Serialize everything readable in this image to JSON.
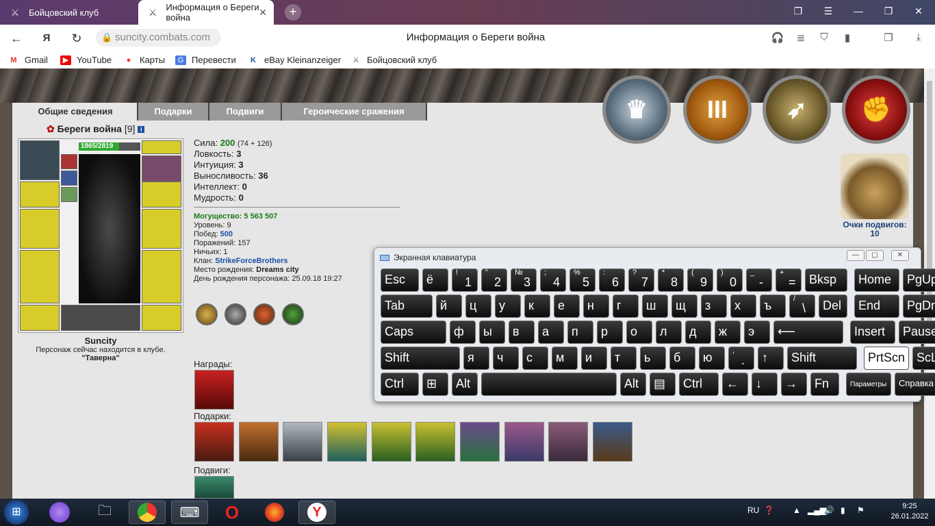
{
  "browser": {
    "tabs": [
      {
        "title": "Бойцовский клуб",
        "icon": "swords-icon",
        "active": false
      },
      {
        "title": "Информация о Береги война",
        "icon": "swords-icon",
        "active": true
      }
    ],
    "url": "suncity.combats.com",
    "page_title": "Информация о Береги война",
    "bookmarks": [
      "Gmail",
      "YouTube",
      "Карты",
      "Перевести",
      "eBay Kleinanzeiger",
      "Бойцовский клуб"
    ]
  },
  "page": {
    "tabs": [
      "Общие сведения",
      "Подарки",
      "Подвиги",
      "Героические сражения"
    ],
    "character": {
      "name": "Береги война",
      "level": "[9]",
      "info_badge": "i",
      "hp": "1865/2819",
      "hp_fraction": 0.66,
      "city": "Suncity",
      "location_text": "Персонаж сейчас находится в клубе.",
      "location": "\"Таверна\""
    },
    "stats": [
      {
        "label": "Сила:",
        "value": "200",
        "extra": "(74 + 126)"
      },
      {
        "label": "Ловкость:",
        "value": "3"
      },
      {
        "label": "Интуиция:",
        "value": "3"
      },
      {
        "label": "Выносливость:",
        "value": "36"
      },
      {
        "label": "Интеллект:",
        "value": "0"
      },
      {
        "label": "Мудрость:",
        "value": "0"
      }
    ],
    "info": {
      "power_label": "Могущество:",
      "power": "5 563 507",
      "level_label": "Уровень:",
      "level": "9",
      "wins_label": "Побед:",
      "wins": "500",
      "losses_label": "Поражений:",
      "losses": "157",
      "draws_label": "Ничьих:",
      "draws": "1",
      "clan_label": "Клан:",
      "clan": "StrikeForceBrothers",
      "birthplace_label": "Место рождения:",
      "birthplace": "Dreams city",
      "birthday_label": "День рождения персонажа:",
      "birthday": "25.09.18 19:27"
    },
    "sections": {
      "awards": "Награды:",
      "gifts": "Подарки:",
      "feats": "Подвиги:"
    },
    "points_label": "Очки подвигов:",
    "points": "10",
    "medal_numeral": "III"
  },
  "osk": {
    "title": "Экранная клавиатура",
    "rows": [
      [
        {
          "l": "Esc"
        },
        {
          "l": "ё"
        },
        {
          "s": "!",
          "m": "1"
        },
        {
          "s": "\"",
          "m": "2"
        },
        {
          "s": "№",
          "m": "3"
        },
        {
          "s": ";",
          "m": "4"
        },
        {
          "s": "%",
          "m": "5"
        },
        {
          "s": ":",
          "m": "6"
        },
        {
          "s": "?",
          "m": "7"
        },
        {
          "s": "*",
          "m": "8"
        },
        {
          "s": "(",
          "m": "9"
        },
        {
          "s": ")",
          "m": "0"
        },
        {
          "s": "_",
          "m": "-"
        },
        {
          "s": "+",
          "m": "="
        },
        {
          "l": "Bksp"
        },
        {
          "l": "Home"
        },
        {
          "l": "PgUp"
        }
      ],
      [
        {
          "l": "Tab"
        },
        {
          "l": "й"
        },
        {
          "l": "ц"
        },
        {
          "l": "у"
        },
        {
          "l": "к"
        },
        {
          "l": "е"
        },
        {
          "l": "н"
        },
        {
          "l": "г"
        },
        {
          "l": "ш"
        },
        {
          "l": "щ"
        },
        {
          "l": "з"
        },
        {
          "l": "х"
        },
        {
          "l": "ъ"
        },
        {
          "s": "/",
          "m": "\\"
        },
        {
          "l": "Del"
        },
        {
          "l": "End"
        },
        {
          "l": "PgDn"
        }
      ],
      [
        {
          "l": "Caps"
        },
        {
          "l": "ф"
        },
        {
          "l": "ы"
        },
        {
          "l": "в"
        },
        {
          "l": "а"
        },
        {
          "l": "п"
        },
        {
          "l": "р"
        },
        {
          "l": "о"
        },
        {
          "l": "л"
        },
        {
          "l": "д"
        },
        {
          "l": "ж"
        },
        {
          "l": "э"
        },
        {
          "l": "⟵"
        },
        {
          "l": "Insert"
        },
        {
          "l": "Pause"
        }
      ],
      [
        {
          "l": "Shift"
        },
        {
          "l": "я"
        },
        {
          "l": "ч"
        },
        {
          "l": "с"
        },
        {
          "l": "м"
        },
        {
          "l": "и"
        },
        {
          "l": "т"
        },
        {
          "l": "ь"
        },
        {
          "l": "б"
        },
        {
          "l": "ю"
        },
        {
          "s": ",",
          "m": "."
        },
        {
          "l": "↑"
        },
        {
          "l": "Shift"
        },
        {
          "l": "PrtScn"
        },
        {
          "l": "ScLk"
        }
      ],
      [
        {
          "l": "Ctrl"
        },
        {
          "l": "⊞"
        },
        {
          "l": "Alt"
        },
        {
          "l": ""
        },
        {
          "l": "Alt"
        },
        {
          "l": "▤"
        },
        {
          "l": "Ctrl"
        },
        {
          "l": "←"
        },
        {
          "l": "↓"
        },
        {
          "l": "→"
        },
        {
          "l": "Fn"
        },
        {
          "l": "Параметры"
        },
        {
          "l": "Справка"
        }
      ]
    ]
  },
  "taskbar": {
    "lang": "RU",
    "time": "9:25",
    "date": "26.01.2022"
  }
}
